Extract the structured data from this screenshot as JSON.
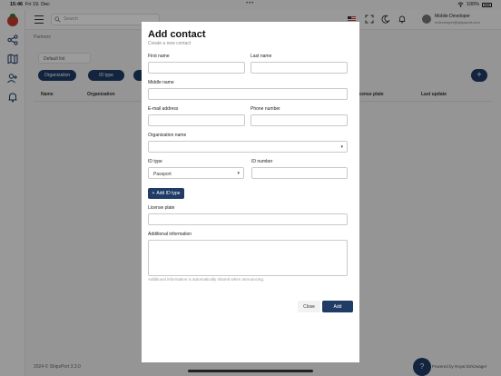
{
  "status_bar": {
    "time": "15:46",
    "date": "Fri 19. Dec",
    "battery": "100%"
  },
  "top_bar": {
    "search_placeholder": "Search",
    "user_name": "Mobile Developer",
    "user_email": "mdeveloper@shipsport.com"
  },
  "page": {
    "breadcrumb": "Partners",
    "list_select": "Default list",
    "filter_pills": [
      "Organization",
      "ID type",
      ""
    ],
    "add_fab": "+",
    "table_headers": [
      "Name",
      "Organization",
      "License plate",
      "Last update"
    ]
  },
  "footer": {
    "copyright": "2024 © ShipzPort 3.3.0",
    "powered": "Powered by Royal Dirkzwager"
  },
  "modal": {
    "title": "Add contact",
    "subtitle": "Create a new contact",
    "fields": {
      "first_name": "First name",
      "last_name": "Last name",
      "middle_name": "Middle name",
      "email": "E-mail address",
      "phone": "Phone number",
      "organization": "Organization name",
      "id_type": "ID type",
      "id_number": "ID number",
      "license_plate": "License plate",
      "additional_info": "Additional information"
    },
    "id_type_value": "Passport",
    "add_id_type_button": "Add ID type",
    "additional_hint": "Additional information is automatically shared when announcing.",
    "close_button": "Close",
    "add_button": "Add"
  },
  "colors": {
    "primary": "#1f3b66",
    "logo": "#c43a2c"
  }
}
